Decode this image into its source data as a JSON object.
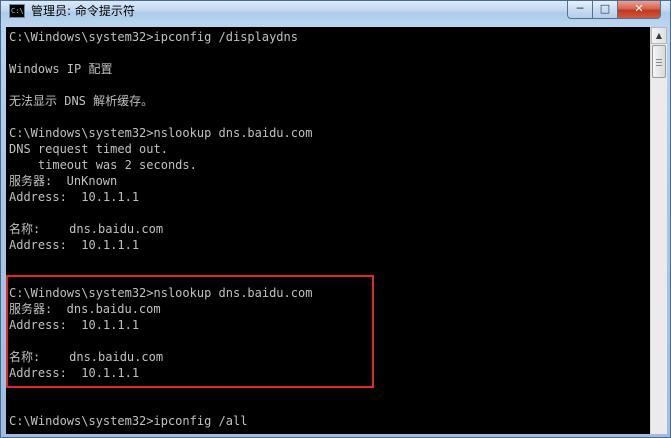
{
  "window": {
    "title": "管理员: 命令提示符",
    "icon": "cmd-icon",
    "icon_text": "C:\\",
    "controls": {
      "minimize": "─",
      "maximize": "□",
      "close": "✕"
    }
  },
  "console": {
    "background": "#000000",
    "foreground": "#c0c0c0",
    "lines": [
      "C:\\Windows\\system32>ipconfig /displaydns",
      "",
      "Windows IP 配置",
      "",
      "无法显示 DNS 解析缓存。",
      "",
      "C:\\Windows\\system32>nslookup dns.baidu.com",
      "DNS request timed out.",
      "    timeout was 2 seconds.",
      "服务器:  UnKnown",
      "Address:  10.1.1.1",
      "",
      "名称:    dns.baidu.com",
      "Address:  10.1.1.1",
      "",
      "",
      "C:\\Windows\\system32>nslookup dns.baidu.com",
      "服务器:  dns.baidu.com",
      "Address:  10.1.1.1",
      "",
      "名称:    dns.baidu.com",
      "Address:  10.1.1.1",
      "",
      "",
      "C:\\Windows\\system32>ipconfig /all"
    ]
  },
  "annotation": {
    "color": "#e0282a"
  },
  "scrollbar": {
    "up_arrow": "▲"
  }
}
